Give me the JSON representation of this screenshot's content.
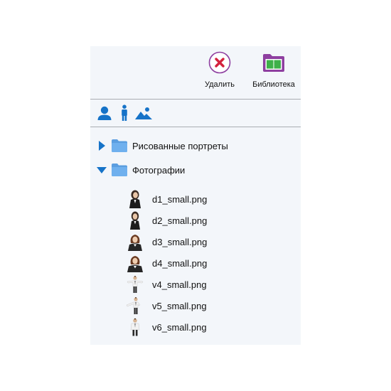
{
  "toolbar": {
    "delete_label": "Удалить",
    "library_label": "Библиотека"
  },
  "filters": {
    "icons": [
      "person-portrait-icon",
      "person-full-icon",
      "landscape-icon"
    ]
  },
  "tree": {
    "folders": [
      {
        "label": "Рисованные портреты",
        "expanded": false
      },
      {
        "label": "Фотографии",
        "expanded": true
      }
    ],
    "files": [
      {
        "label": "d1_small.png"
      },
      {
        "label": "d2_small.png"
      },
      {
        "label": "d3_small.png"
      },
      {
        "label": "d4_small.png"
      },
      {
        "label": "v4_small.png"
      },
      {
        "label": "v5_small.png"
      },
      {
        "label": "v6_small.png"
      }
    ]
  },
  "colors": {
    "panel_bg": "#f3f6fa",
    "accent_blue": "#1673c8",
    "folder_blue": "#5b9ee0",
    "delete_red": "#d4213d",
    "library_purple": "#8e3fa0",
    "library_green": "#3fb04a"
  }
}
